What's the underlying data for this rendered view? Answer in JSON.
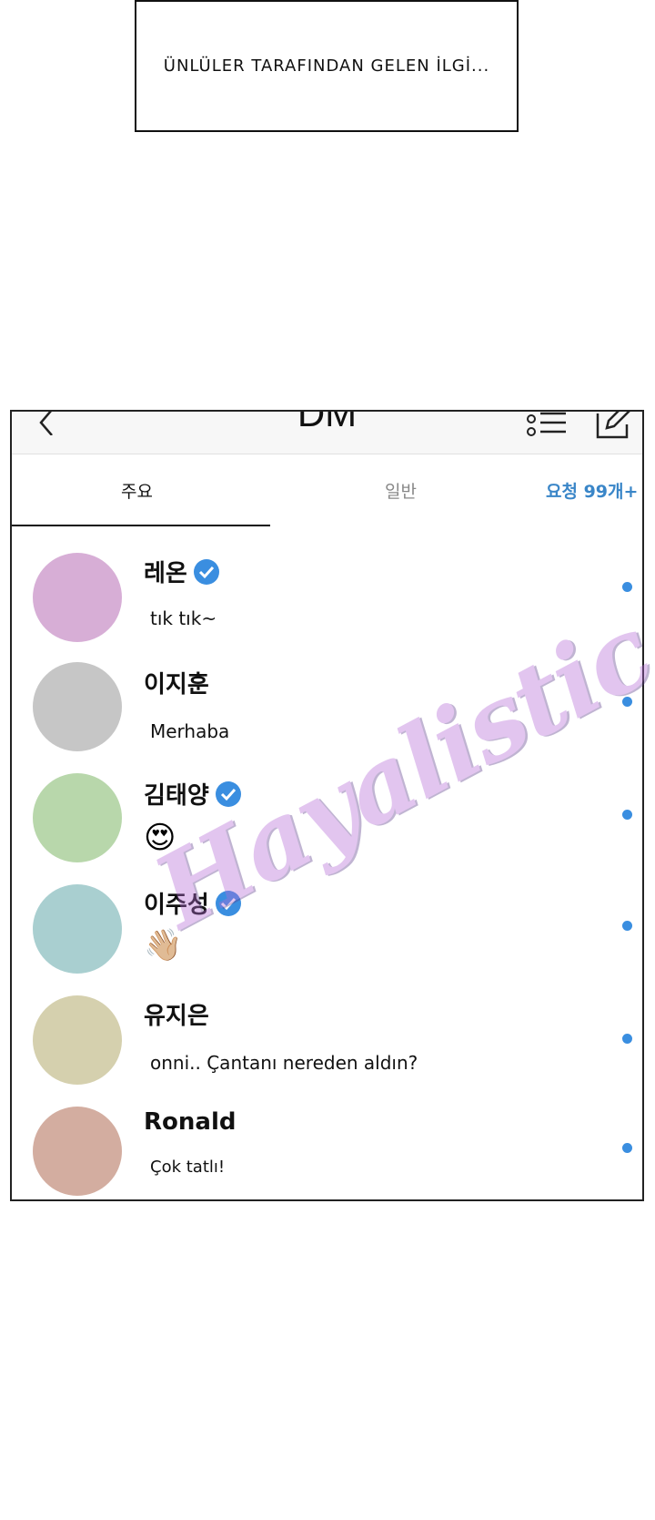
{
  "caption": {
    "text": "ÜNLÜLER TARAFINDAN GELEN İLGİ..."
  },
  "header": {
    "title": "DM",
    "back_icon": "chevron-left-icon",
    "list_icon": "list-icon",
    "compose_icon": "compose-icon"
  },
  "tabs": {
    "main": "주요",
    "general": "일반",
    "requests": "요청 99개+"
  },
  "colors": {
    "accent": "#3a8ee0",
    "verified": "#3a8ee0"
  },
  "chats": [
    {
      "name": "레온",
      "verified": true,
      "message": "tık tık~",
      "avatar_color": "#d7aed6",
      "unread": true
    },
    {
      "name": "이지훈",
      "verified": false,
      "message": "Merhaba",
      "avatar_color": "#c6c6c6",
      "unread": true
    },
    {
      "name": "김태양",
      "verified": true,
      "message": "😍",
      "avatar_color": "#b8d7ab",
      "unread": true
    },
    {
      "name": "이주성",
      "verified": true,
      "message": "👋🏼",
      "avatar_color": "#a9cfd0",
      "unread": true
    },
    {
      "name": "유지은",
      "verified": false,
      "message": "onni.. Çantanı nereden aldın?",
      "avatar_color": "#d5d0ae",
      "unread": true
    },
    {
      "name": "Ronald",
      "verified": false,
      "message": "Çok tatlı!",
      "avatar_color": "#d3ada0",
      "unread": true
    }
  ],
  "watermark": {
    "text": "Hayalistic"
  }
}
